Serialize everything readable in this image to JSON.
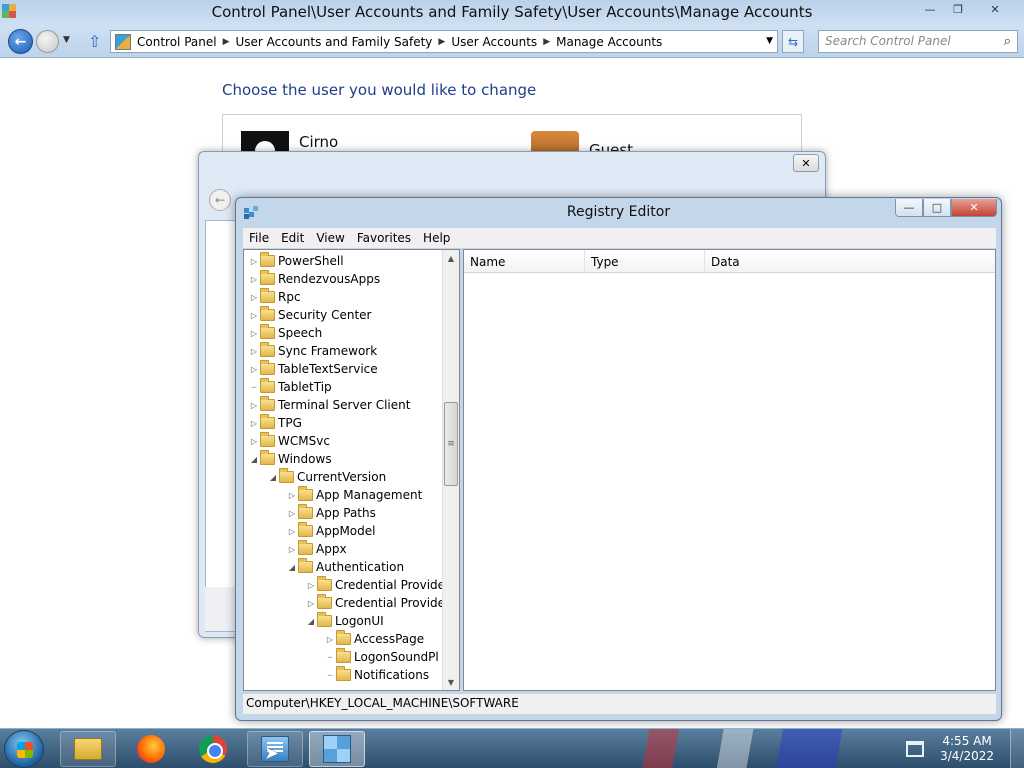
{
  "control_panel": {
    "title": "Control Panel\\User Accounts and Family Safety\\User Accounts\\Manage Accounts",
    "breadcrumbs": [
      "Control Panel",
      "User Accounts and Family Safety",
      "User Accounts",
      "Manage Accounts"
    ],
    "search_placeholder": "Search Control Panel",
    "heading": "Choose the user you would like to change",
    "accounts": [
      {
        "name": "Cirno"
      },
      {
        "name": "Guest"
      }
    ]
  },
  "registry_editor": {
    "title": "Registry Editor",
    "menu": [
      "File",
      "Edit",
      "View",
      "Favorites",
      "Help"
    ],
    "tree": [
      {
        "label": "PowerShell",
        "level": 0,
        "expander": "collapsed"
      },
      {
        "label": "RendezvousApps",
        "level": 0,
        "expander": "collapsed"
      },
      {
        "label": "Rpc",
        "level": 0,
        "expander": "collapsed"
      },
      {
        "label": "Security Center",
        "level": 0,
        "expander": "collapsed"
      },
      {
        "label": "Speech",
        "level": 0,
        "expander": "collapsed"
      },
      {
        "label": "Sync Framework",
        "level": 0,
        "expander": "collapsed"
      },
      {
        "label": "TableTextService",
        "level": 0,
        "expander": "collapsed"
      },
      {
        "label": "TabletTip",
        "level": 0,
        "expander": "none"
      },
      {
        "label": "Terminal Server Client",
        "level": 0,
        "expander": "collapsed"
      },
      {
        "label": "TPG",
        "level": 0,
        "expander": "collapsed"
      },
      {
        "label": "WCMSvc",
        "level": 0,
        "expander": "collapsed"
      },
      {
        "label": "Windows",
        "level": 0,
        "expander": "expanded"
      },
      {
        "label": "CurrentVersion",
        "level": 1,
        "expander": "expanded"
      },
      {
        "label": "App Management",
        "level": 2,
        "expander": "collapsed"
      },
      {
        "label": "App Paths",
        "level": 2,
        "expander": "collapsed"
      },
      {
        "label": "AppModel",
        "level": 2,
        "expander": "collapsed"
      },
      {
        "label": "Appx",
        "level": 2,
        "expander": "collapsed"
      },
      {
        "label": "Authentication",
        "level": 2,
        "expander": "expanded"
      },
      {
        "label": "Credential Provide",
        "level": 3,
        "expander": "collapsed"
      },
      {
        "label": "Credential Provide",
        "level": 3,
        "expander": "collapsed"
      },
      {
        "label": "LogonUI",
        "level": 3,
        "expander": "expanded"
      },
      {
        "label": "AccessPage",
        "level": 4,
        "expander": "collapsed"
      },
      {
        "label": "LogonSoundPl",
        "level": 4,
        "expander": "none"
      },
      {
        "label": "Notifications",
        "level": 4,
        "expander": "none"
      }
    ],
    "columns": [
      "Name",
      "Type",
      "Data"
    ],
    "status_path": "Computer\\HKEY_LOCAL_MACHINE\\SOFTWARE"
  },
  "taskbar": {
    "time": "4:55 AM",
    "date": "3/4/2022"
  },
  "icons": {
    "back": "back-arrow-icon",
    "forward": "forward-arrow-icon",
    "up": "up-arrow-icon",
    "refresh": "refresh-icon",
    "search": "magnifier-icon",
    "folder": "folder-icon",
    "start": "windows-start-orb"
  }
}
